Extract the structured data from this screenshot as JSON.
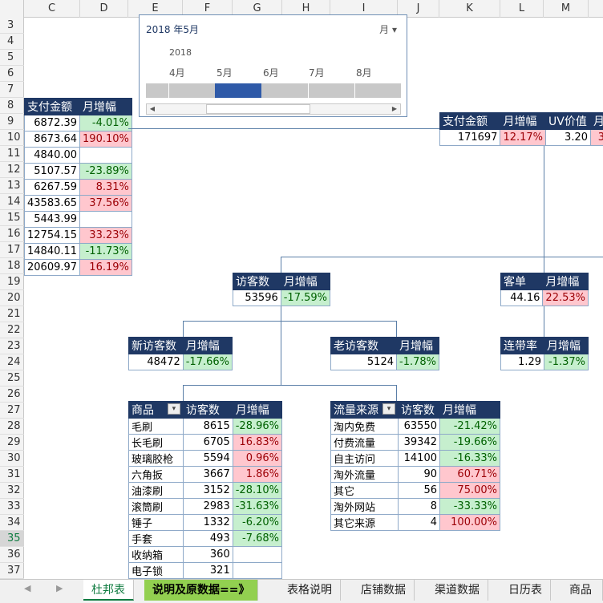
{
  "columns": [
    "C",
    "D",
    "E",
    "F",
    "G",
    "H",
    "I",
    "J",
    "K",
    "L",
    "M"
  ],
  "rows": [
    "3",
    "4",
    "5",
    "6",
    "7",
    "8",
    "9",
    "10",
    "11",
    "12",
    "13",
    "14",
    "15",
    "16",
    "17",
    "18",
    "19",
    "20",
    "21",
    "22",
    "23",
    "24",
    "25",
    "26",
    "27",
    "28",
    "29",
    "30",
    "31",
    "32",
    "33",
    "34",
    "35",
    "36",
    "37"
  ],
  "selected_row": "35",
  "timeline": {
    "title": "2018 年5月",
    "level": "月",
    "year": "2018",
    "months": [
      "4月",
      "5月",
      "6月",
      "7月",
      "8月"
    ]
  },
  "left_table": {
    "headers": [
      "支付金额",
      "月增幅"
    ],
    "rows": [
      [
        "6872.39",
        "-4.01%"
      ],
      [
        "8673.64",
        "190.10%"
      ],
      [
        "4840.00",
        ""
      ],
      [
        "5107.57",
        "-23.89%"
      ],
      [
        "6267.59",
        "8.31%"
      ],
      [
        "43583.65",
        "37.56%"
      ],
      [
        "5443.99",
        ""
      ],
      [
        "12754.15",
        "33.23%"
      ],
      [
        "14840.11",
        "-11.73%"
      ],
      [
        "20609.97",
        "16.19%"
      ]
    ]
  },
  "top_kpi": {
    "headers": [
      "支付金额",
      "月增幅",
      "UV价值",
      "月"
    ],
    "values": [
      "171697",
      "12.17%",
      "3.20",
      "3"
    ]
  },
  "visitors": {
    "headers": [
      "访客数",
      "月增幅"
    ],
    "values": [
      "53596",
      "-17.59%"
    ]
  },
  "order": {
    "headers": [
      "客单",
      "月增幅"
    ],
    "values": [
      "44.16",
      "22.53%"
    ]
  },
  "new_visitors": {
    "headers": [
      "新访客数",
      "月增幅"
    ],
    "values": [
      "48472",
      "-17.66%"
    ]
  },
  "old_visitors": {
    "headers": [
      "老访客数",
      "月增幅"
    ],
    "values": [
      "5124",
      "-1.78%"
    ]
  },
  "attach_rate": {
    "headers": [
      "连带率",
      "月增幅"
    ],
    "values": [
      "1.29",
      "-1.37%"
    ]
  },
  "products": {
    "headers": [
      "商品",
      "访客数",
      "月增幅"
    ],
    "rows": [
      [
        "毛刷",
        "8615",
        "-28.96%"
      ],
      [
        "长毛刷",
        "6705",
        "16.83%"
      ],
      [
        "玻璃胶枪",
        "5594",
        "0.96%"
      ],
      [
        "六角扳",
        "3667",
        "1.86%"
      ],
      [
        "油漆刷",
        "3152",
        "-28.10%"
      ],
      [
        "滚筒刷",
        "2983",
        "-31.63%"
      ],
      [
        "锤子",
        "1332",
        "-6.20%"
      ],
      [
        "手套",
        "493",
        "-7.68%"
      ],
      [
        "收纳箱",
        "360",
        ""
      ],
      [
        "电子锁",
        "321",
        ""
      ]
    ]
  },
  "traffic": {
    "headers": [
      "流量来源",
      "访客数",
      "月增幅"
    ],
    "rows": [
      [
        "淘内免费",
        "63550",
        "-21.42%"
      ],
      [
        "付费流量",
        "39342",
        "-19.66%"
      ],
      [
        "自主访问",
        "14100",
        "-16.33%"
      ],
      [
        "淘外流量",
        "90",
        "60.71%"
      ],
      [
        "其它",
        "56",
        "75.00%"
      ],
      [
        "淘外网站",
        "8",
        "-33.33%"
      ],
      [
        "其它来源",
        "4",
        "100.00%"
      ]
    ]
  },
  "tabs": [
    "杜邦表",
    "说明及原数据==》",
    "表格说明",
    "店铺数据",
    "渠道数据",
    "日历表",
    "商品数"
  ]
}
